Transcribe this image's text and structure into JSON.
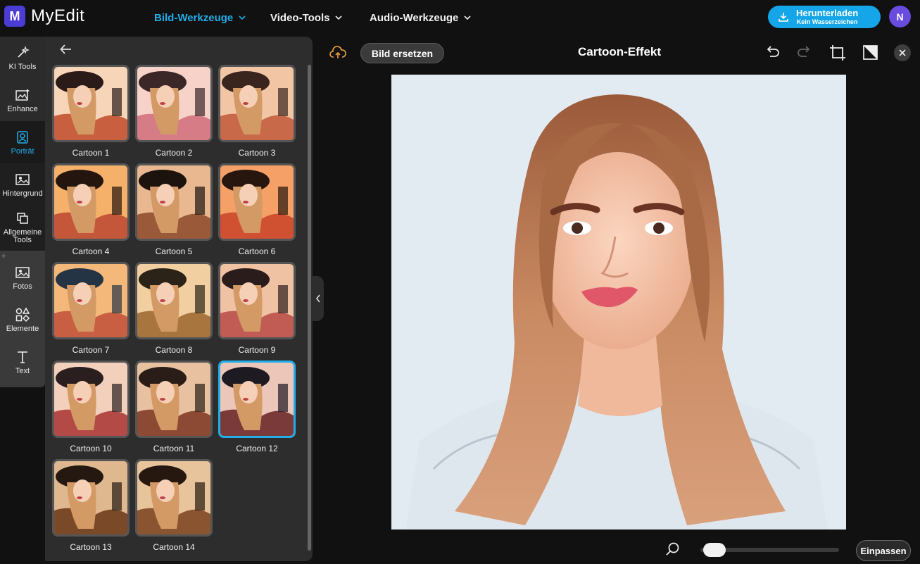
{
  "app": {
    "logo_letter": "M",
    "name": "MyEdit"
  },
  "nav": [
    {
      "label": "Bild-Werkzeuge",
      "active": true
    },
    {
      "label": "Video-Tools",
      "active": false
    },
    {
      "label": "Audio-Werkzeuge",
      "active": false
    }
  ],
  "download": {
    "label": "Herunterladen",
    "sublabel": "Kein Wasserzeichen"
  },
  "user": {
    "initial": "N"
  },
  "rail": [
    {
      "label": "KI Tools",
      "icon": "magic-wand-icon"
    },
    {
      "label": "Enhance",
      "icon": "image-enhance-icon"
    },
    {
      "label": "Porträt",
      "icon": "portrait-icon",
      "selected": true
    },
    {
      "label": "Hintergrund",
      "icon": "background-icon"
    },
    {
      "label": "Allgemeine Tools",
      "icon": "general-tools-icon"
    },
    {
      "label": "Fotos",
      "icon": "photos-icon"
    },
    {
      "label": "Elemente",
      "icon": "elements-icon"
    },
    {
      "label": "Text",
      "icon": "text-icon"
    }
  ],
  "presets": [
    {
      "label": "Cartoon 1"
    },
    {
      "label": "Cartoon 2"
    },
    {
      "label": "Cartoon 3"
    },
    {
      "label": "Cartoon 4"
    },
    {
      "label": "Cartoon 5"
    },
    {
      "label": "Cartoon 6"
    },
    {
      "label": "Cartoon 7"
    },
    {
      "label": "Cartoon 8"
    },
    {
      "label": "Cartoon 9"
    },
    {
      "label": "Cartoon 10"
    },
    {
      "label": "Cartoon 11"
    },
    {
      "label": "Cartoon 12",
      "selected": true
    },
    {
      "label": "Cartoon 13"
    },
    {
      "label": "Cartoon 14"
    }
  ],
  "editor": {
    "replace_label": "Bild ersetzen",
    "title": "Cartoon-Effekt",
    "fit_label": "Einpassen",
    "zoom_level": 0.05
  },
  "colors": {
    "accent": "#22aeea",
    "brand": "#4b3cd6",
    "download": "#14a6e9"
  }
}
